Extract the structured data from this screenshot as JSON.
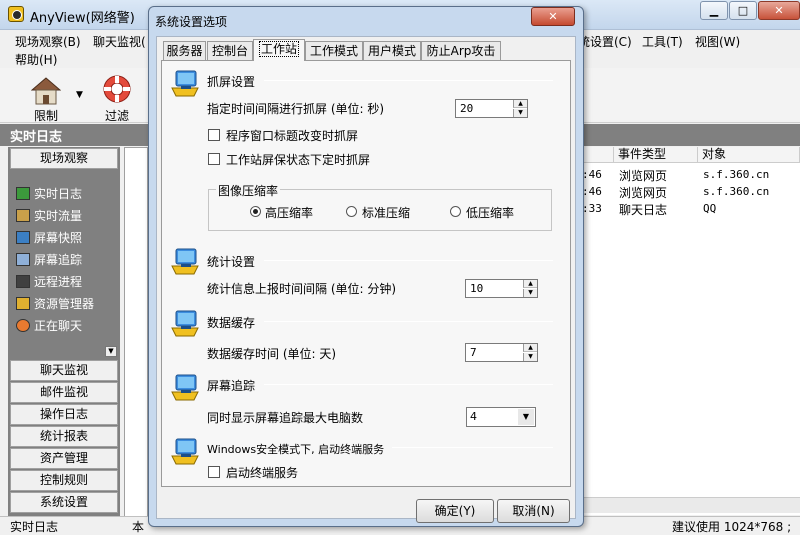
{
  "main_window": {
    "title": "AnyView(网络警)",
    "caption_min": "▁",
    "caption_max": "□",
    "caption_close": "✕"
  },
  "menu": {
    "row1": [
      "现场观察(B)",
      "聊天监视(",
      "统设置(C)",
      "工具(T)",
      "视图(W)"
    ],
    "row2": [
      "帮助(H)"
    ]
  },
  "toolbar": {
    "restrict_label": "限制",
    "filter_label": "过滤",
    "dropdown": "▼"
  },
  "log_title": "实时日志",
  "nav": {
    "top_button": "现场观察",
    "links": [
      "实时日志",
      "实时流量",
      "屏幕快照",
      "屏幕追踪",
      "远程进程",
      "资源管理器",
      "正在聊天"
    ],
    "buttons": [
      "聊天监视",
      "邮件监视",
      "操作日志",
      "统计报表",
      "资产管理",
      "控制规则",
      "系统设置"
    ]
  },
  "grid": {
    "headers": [
      "事件类型",
      "对象"
    ],
    "rows": [
      {
        "time": ":46",
        "type": "浏览网页",
        "object": "s.f.360.cn"
      },
      {
        "time": ":46",
        "type": "浏览网页",
        "object": "s.f.360.cn"
      },
      {
        "time": ":33",
        "type": "聊天日志",
        "object": "QQ"
      }
    ]
  },
  "statusbar": {
    "left": "实时日志",
    "mid": "本",
    "right": "建议使用 1024*768 ;"
  },
  "dialog": {
    "title": "系统设置选项",
    "close": "✕",
    "tabs": [
      "服务器",
      "控制台",
      "工作站",
      "工作模式",
      "用户模式",
      "防止Arp攻击"
    ],
    "active_tab": "工作站",
    "capture": {
      "title": "抓屏设置",
      "interval_label": "指定时间间隔进行抓屏 (单位: 秒)",
      "interval_value": "20",
      "cb1": "程序窗口标题改变时抓屏",
      "cb2": "工作站屏保状态下定时抓屏"
    },
    "compress": {
      "title": "图像压缩率",
      "options": [
        "高压缩率",
        "标准压缩",
        "低压缩率"
      ],
      "selected": "高压缩率"
    },
    "stats": {
      "title": "统计设置",
      "label": "统计信息上报时间间隔 (单位: 分钟)",
      "value": "10"
    },
    "cache": {
      "title": "数据缓存",
      "label": "数据缓存时间 (单位: 天)",
      "value": "7"
    },
    "tracking": {
      "title": "屏幕追踪",
      "label": "同时显示屏幕追踪最大电脑数",
      "value": "4"
    },
    "safemode": {
      "title": "Windows安全模式下, 启动终端服务",
      "cb": "启动终端服务"
    },
    "ok": "确定(Y)",
    "cancel": "取消(N)"
  }
}
